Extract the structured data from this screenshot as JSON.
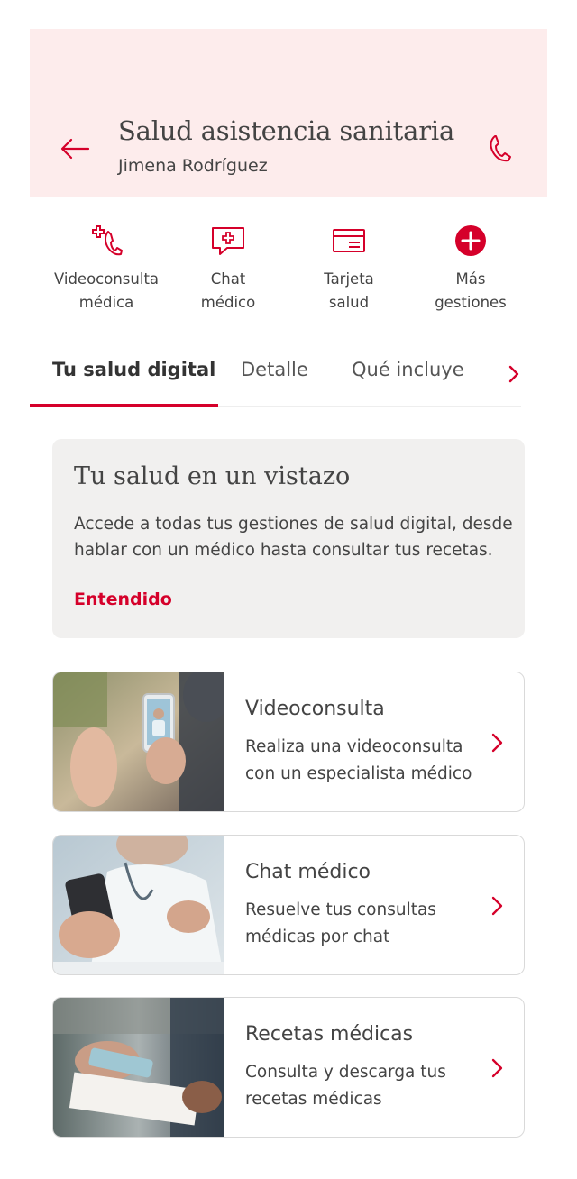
{
  "header": {
    "title": "Salud asistencia sanitaria",
    "subtitle": "Jimena Rodríguez"
  },
  "quick_actions": [
    {
      "line1": "Videoconsulta",
      "line2": "médica",
      "icon": "video-consult-icon"
    },
    {
      "line1": "Chat",
      "line2": "médico",
      "icon": "medical-chat-icon"
    },
    {
      "line1": "Tarjeta",
      "line2": "salud",
      "icon": "health-card-icon"
    },
    {
      "line1": "Más",
      "line2": "gestiones",
      "icon": "plus-circle-icon"
    }
  ],
  "tabs": [
    {
      "label": "Tu salud digital",
      "active": true
    },
    {
      "label": "Detalle",
      "active": false
    },
    {
      "label": "Qué incluye",
      "active": false
    }
  ],
  "info_card": {
    "title": "Tu salud en un vistazo",
    "description": "Accede a todas tus gestiones de salud digital, desde hablar con un médico hasta consultar tus recetas.",
    "action": "Entendido"
  },
  "services": [
    {
      "title": "Videoconsulta",
      "description": "Realiza una videoconsulta con un especialista médico",
      "image": "video-call-photo"
    },
    {
      "title": "Chat médico",
      "description": "Resuelve tus consultas médicas por chat",
      "image": "doctor-phone-photo"
    },
    {
      "title": "Recetas médicas",
      "description": "Consulta y descarga tus recetas médicas",
      "image": "prescription-photo"
    }
  ],
  "colors": {
    "brand_red": "#d5002a",
    "header_bg": "#fdecec",
    "card_bg": "#f1f0ef",
    "text": "#444444"
  }
}
